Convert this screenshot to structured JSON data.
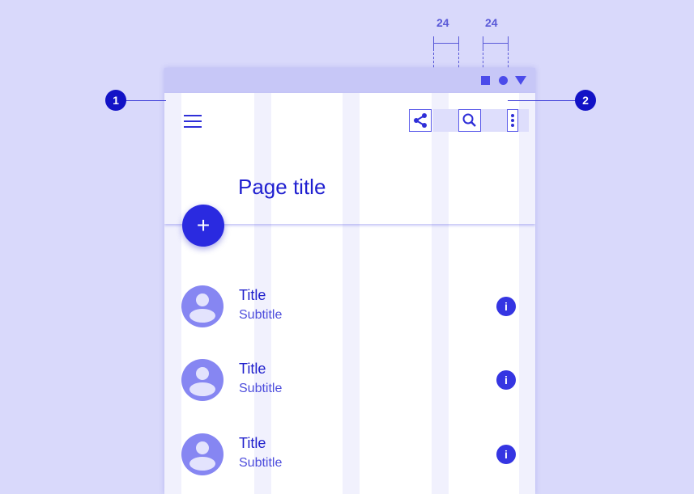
{
  "appbar": {
    "page_title": "Page title"
  },
  "fab": {
    "label": "+"
  },
  "list": {
    "items": [
      {
        "title": "Title",
        "subtitle": "Subtitle",
        "info_glyph": "i"
      },
      {
        "title": "Title",
        "subtitle": "Subtitle",
        "info_glyph": "i"
      },
      {
        "title": "Title",
        "subtitle": "Subtitle",
        "info_glyph": "i"
      }
    ]
  },
  "annotations": {
    "callout_1": "1",
    "callout_2": "2",
    "spacing_1": "24",
    "spacing_2": "24"
  },
  "icons": [
    "menu-icon",
    "share-icon",
    "search-icon",
    "more-vert-icon",
    "add-icon",
    "info-icon",
    "account-icon",
    "status-square-icon",
    "status-circle-icon",
    "status-triangle-icon"
  ],
  "colors": {
    "background": "#d9d9fb",
    "primary": "#2a2ae0",
    "title_text": "#1f1fd0",
    "avatar": "#8686f2",
    "callout": "#1212c6"
  }
}
